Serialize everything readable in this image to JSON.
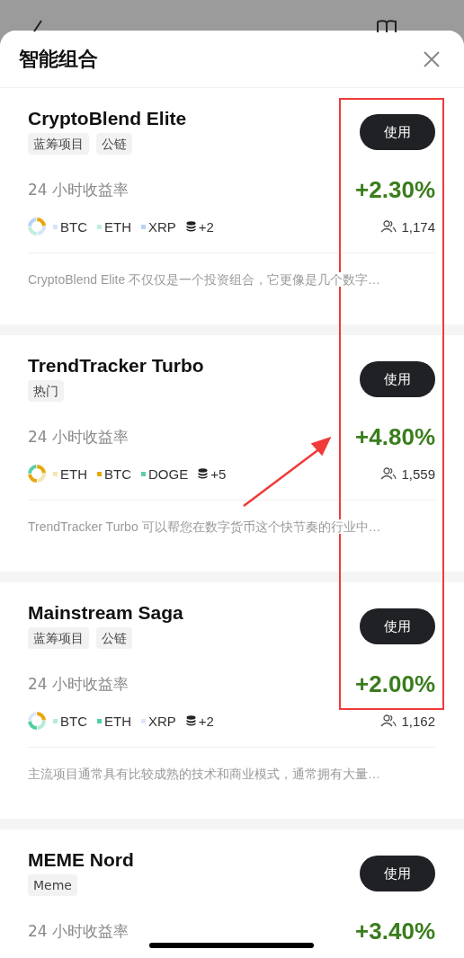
{
  "sheet": {
    "title": "智能组合"
  },
  "portfolios": [
    {
      "name": "CryptoBlend Elite",
      "tags": [
        "蓝筹项目",
        "公链"
      ],
      "button": "使用",
      "return_label": "24 小时收益率",
      "return_value": "+2.30%",
      "coins": [
        {
          "symbol": "BTC",
          "color": "#d6e4fb"
        },
        {
          "symbol": "ETH",
          "color": "#bfeedd"
        },
        {
          "symbol": "XRP",
          "color": "#b9d3f8"
        }
      ],
      "more": "+2",
      "followers": "1,174",
      "description": "CryptoBlend Elite 不仅仅是一个投资组合，它更像是几个数字…"
    },
    {
      "name": "TrendTracker Turbo",
      "tags": [
        "热门"
      ],
      "button": "使用",
      "return_label": "24 小时收益率",
      "return_value": "+4.80%",
      "coins": [
        {
          "symbol": "ETH",
          "color": "#f7e6b5"
        },
        {
          "symbol": "BTC",
          "color": "#e8a80c"
        },
        {
          "symbol": "DOGE",
          "color": "#5ad0a6"
        }
      ],
      "more": "+5",
      "followers": "1,559",
      "description": "TrendTracker Turbo 可以帮您在数字货币这个快节奏的行业中…"
    },
    {
      "name": "Mainstream Saga",
      "tags": [
        "蓝筹项目",
        "公链"
      ],
      "button": "使用",
      "return_label": "24 小时收益率",
      "return_value": "+2.00%",
      "coins": [
        {
          "symbol": "BTC",
          "color": "#b4ecd6"
        },
        {
          "symbol": "ETH",
          "color": "#4fd09f"
        },
        {
          "symbol": "XRP",
          "color": "#dde7fb"
        }
      ],
      "more": "+2",
      "followers": "1,162",
      "description": "主流项目通常具有比较成熟的技术和商业模式，通常拥有大量…"
    },
    {
      "name": "MEME Nord",
      "tags": [
        "Meme"
      ],
      "button": "使用",
      "return_label": "24 小时收益率",
      "return_value": "+3.40%"
    }
  ]
}
